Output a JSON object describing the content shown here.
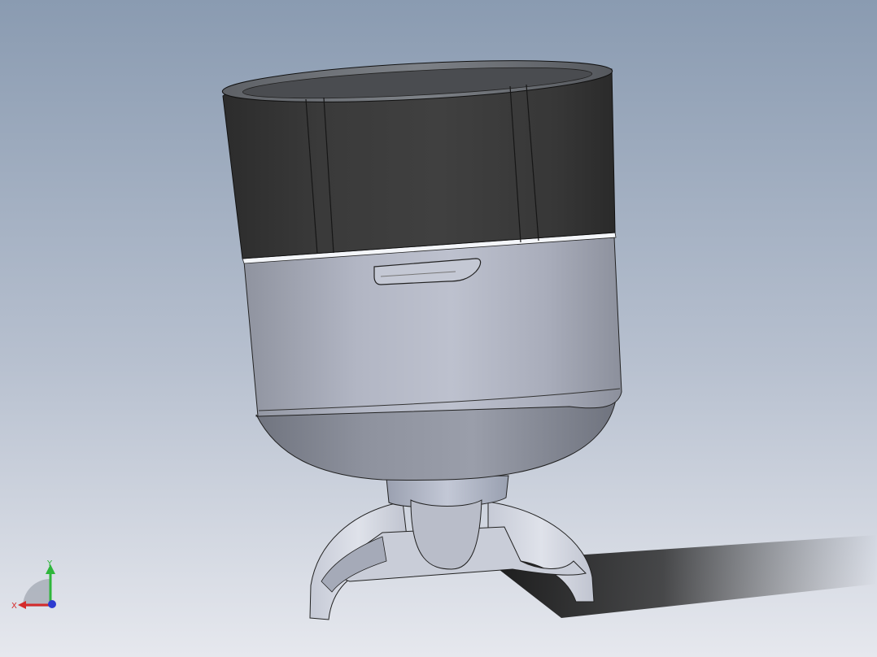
{
  "triad": {
    "x_label": "X",
    "y_label": "Y"
  },
  "colors": {
    "background_top": "#8a9bb1",
    "background_bottom": "#e6e8ee",
    "body_dark": "#3d3d3d",
    "body_gray": "#b4b8c6",
    "x_axis": "#d52b2b",
    "y_axis": "#2fb63b",
    "z_axis": "#2d3bd0"
  }
}
